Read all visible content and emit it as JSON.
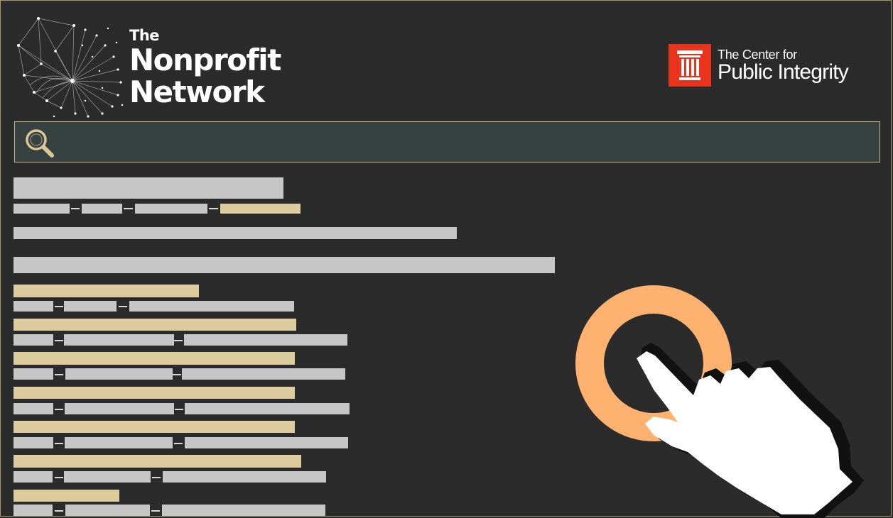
{
  "header": {
    "brand_the": "The",
    "brand_line1": "Nonprofit",
    "brand_line2": "Network",
    "partner_line1": "The Center for",
    "partner_line2": "Public Integrity"
  },
  "search": {
    "placeholder": "",
    "value": ""
  },
  "icons": {
    "logo": "network-graph-icon",
    "partner_logo": "column-pillar-icon",
    "search": "magnifier-icon",
    "cursor": "hand-pointer-icon",
    "click_ring": "click-ring-icon"
  },
  "colors": {
    "background": "#2a2b2a",
    "accent_tan": "#dccb9c",
    "placeholder_grey": "#c6c6c6",
    "partner_red": "#e8341c",
    "click_ring": "#ffb26f"
  }
}
